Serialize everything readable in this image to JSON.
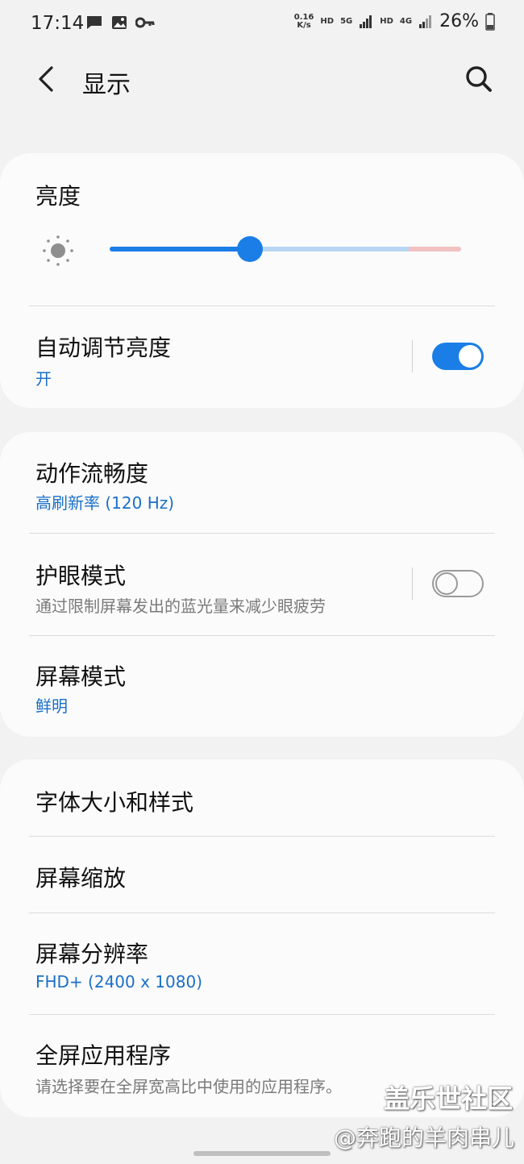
{
  "status_bar": {
    "time": "17:14",
    "net_speed_top": "0.16",
    "net_speed_bottom": "K/s",
    "hd1": "HD",
    "signal1_label": "5G",
    "hd2": "HD",
    "signal2_label": "4G",
    "battery": "26%",
    "icons": [
      "message-icon",
      "image-icon",
      "key-icon",
      "signal-icon",
      "battery-icon"
    ]
  },
  "header": {
    "title": "显示",
    "back_icon": "chevron-left-icon",
    "search_icon": "search-icon"
  },
  "brightness": {
    "title": "亮度",
    "level": 0.4,
    "warn_start": 0.85,
    "icon": "sun-icon"
  },
  "auto_brightness": {
    "title": "自动调节亮度",
    "status": "开",
    "enabled": true
  },
  "motion_smoothness": {
    "title": "动作流畅度",
    "value": "高刷新率 (120 Hz)"
  },
  "eye_comfort": {
    "title": "护眼模式",
    "desc": "通过限制屏幕发出的蓝光量来减少眼疲劳",
    "enabled": false
  },
  "screen_mode": {
    "title": "屏幕模式",
    "value": "鲜明"
  },
  "font_size": {
    "title": "字体大小和样式"
  },
  "screen_zoom": {
    "title": "屏幕缩放"
  },
  "resolution": {
    "title": "屏幕分辨率",
    "value": "FHD+ (2400 x 1080)"
  },
  "full_screen_apps": {
    "title": "全屏应用程序",
    "desc": "请选择要在全屏宽高比中使用的应用程序。"
  },
  "watermark": {
    "line1": "盖乐世社区",
    "line2": "@奔跑的羊肉串儿"
  },
  "colors": {
    "accent": "#1a7ee6",
    "accent_text": "#1a6fc8",
    "background": "#f2f2f2",
    "card": "#fbfbfb"
  }
}
